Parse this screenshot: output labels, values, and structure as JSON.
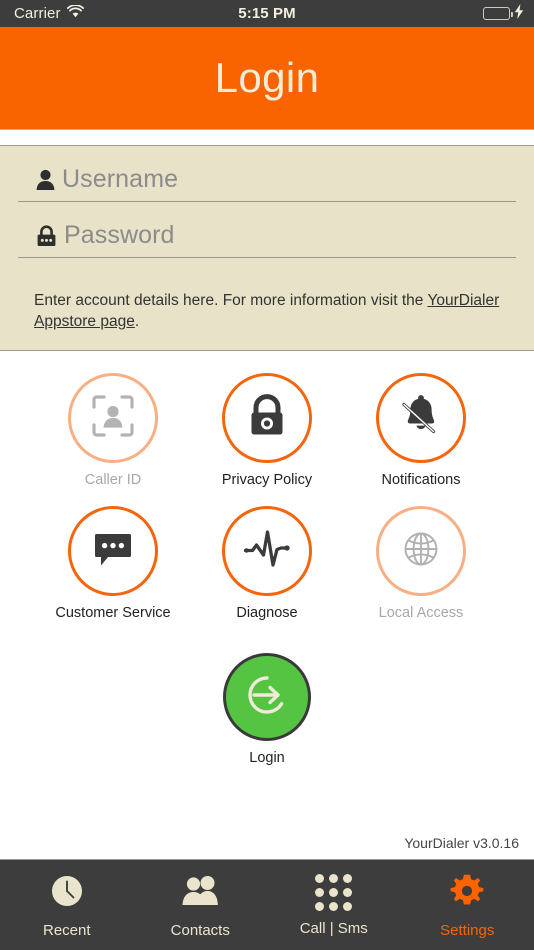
{
  "status_bar": {
    "carrier": "Carrier",
    "wifi_icon": "wifi-icon",
    "time": "5:15 PM",
    "battery_icon": "battery-full-icon",
    "charging_icon": "lightning-bolt-icon"
  },
  "header": {
    "title": "Login",
    "background_color": "#fa6400",
    "title_color": "#f2ecd8"
  },
  "form": {
    "background_color": "#e8e2c8",
    "username": {
      "icon": "person-icon",
      "value": "",
      "placeholder": "Username"
    },
    "password": {
      "icon": "lock-icon",
      "value": "",
      "placeholder": "Password"
    },
    "hint_prefix": "Enter account details here. For more information visit the ",
    "hint_link": "YourDialer Appstore page",
    "hint_suffix": "."
  },
  "grid": {
    "accent_color": "#f4650c",
    "disabled_color": "#f7b083",
    "rows": [
      [
        {
          "label": "Caller ID",
          "icon": "caller-id-scan-icon",
          "enabled": false
        },
        {
          "label": "Privacy Policy",
          "icon": "lock-icon",
          "enabled": true
        },
        {
          "label": "Notifications",
          "icon": "bell-slash-icon",
          "enabled": true
        }
      ],
      [
        {
          "label": "Customer Service",
          "icon": "chat-bubble-icon",
          "enabled": true
        },
        {
          "label": "Diagnose",
          "icon": "pulse-icon",
          "enabled": true
        },
        {
          "label": "Local Access",
          "icon": "globe-icon",
          "enabled": false
        }
      ]
    ]
  },
  "login_button": {
    "label": "Login",
    "icon": "sign-in-arrow-icon",
    "color": "#55c443"
  },
  "version": "YourDialer v3.0.16",
  "tabbar": {
    "background_color": "#3d3d3d",
    "active_color": "#fa6400",
    "items": [
      {
        "label": "Recent",
        "icon": "clock-icon",
        "active": false
      },
      {
        "label": "Contacts",
        "icon": "people-icon",
        "active": false
      },
      {
        "label": "Call | Sms",
        "icon": "keypad-icon",
        "active": false
      },
      {
        "label": "Settings",
        "icon": "gear-icon",
        "active": true
      }
    ]
  }
}
